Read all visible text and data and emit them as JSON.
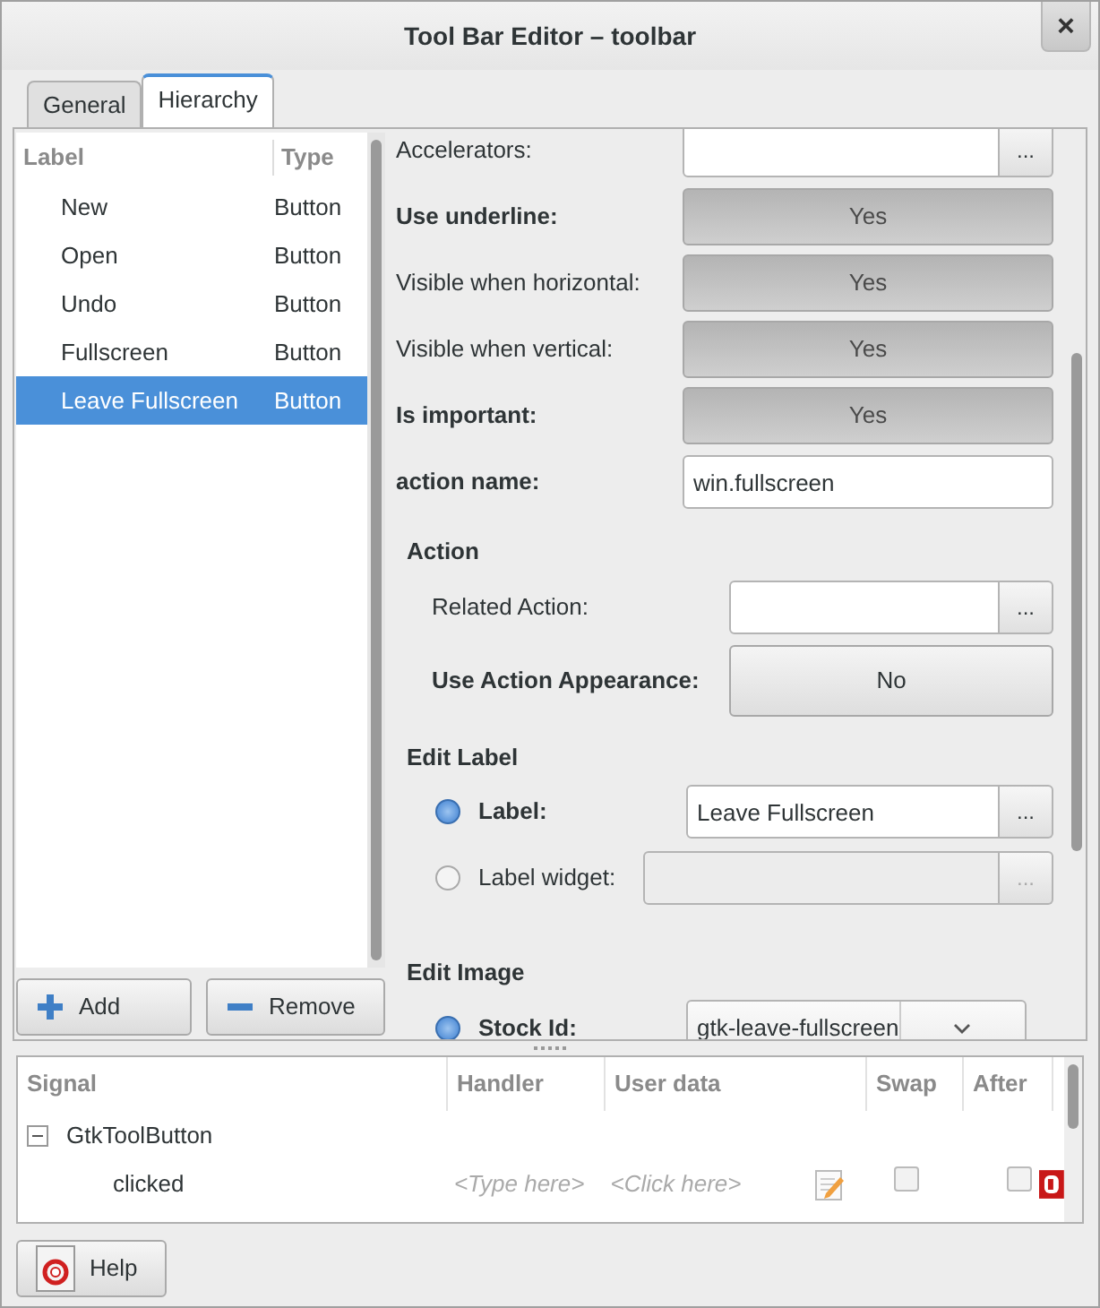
{
  "window": {
    "title": "Tool Bar Editor – toolbar",
    "close": "×"
  },
  "tabs": [
    {
      "label": "General",
      "selected": false
    },
    {
      "label": "Hierarchy",
      "selected": true
    }
  ],
  "hierarchy": {
    "columns": [
      "Label",
      "Type"
    ],
    "rows": [
      {
        "label": "New",
        "type": "Button",
        "selected": false
      },
      {
        "label": "Open",
        "type": "Button",
        "selected": false
      },
      {
        "label": "Undo",
        "type": "Button",
        "selected": false
      },
      {
        "label": "Fullscreen",
        "type": "Button",
        "selected": false
      },
      {
        "label": "Leave Fullscreen",
        "type": "Button",
        "selected": true
      }
    ],
    "buttons": [
      {
        "kind": "add",
        "label": "Add"
      },
      {
        "kind": "remove",
        "label": "Remove"
      }
    ]
  },
  "properties": {
    "rows": [
      {
        "kind": "entry-button",
        "label": "Accelerators:",
        "bold": false,
        "value": "",
        "button": "..."
      },
      {
        "kind": "toggle",
        "label": "Use underline:",
        "bold": true,
        "value": "Yes",
        "active": true
      },
      {
        "kind": "toggle",
        "label": "Visible when horizontal:",
        "bold": false,
        "value": "Yes",
        "active": true
      },
      {
        "kind": "toggle",
        "label": "Visible when vertical:",
        "bold": false,
        "value": "Yes",
        "active": true
      },
      {
        "kind": "toggle",
        "label": "Is important:",
        "bold": true,
        "value": "Yes",
        "active": true
      },
      {
        "kind": "entry",
        "label": "action name:",
        "bold": true,
        "value": "win.fullscreen"
      }
    ],
    "sections": [
      {
        "heading": "Action",
        "rows": [
          {
            "kind": "entry-button",
            "label": "Related Action:",
            "bold": false,
            "value": "",
            "button": "..."
          },
          {
            "kind": "toggle",
            "label": "Use Action Appearance:",
            "bold": true,
            "value": "No",
            "active": false
          }
        ]
      },
      {
        "heading": "Edit Label",
        "rows": [
          {
            "kind": "radio-entry",
            "label": "Label:",
            "bold": true,
            "selected": true,
            "value": "Leave Fullscreen",
            "button": "...",
            "disabled": false
          },
          {
            "kind": "radio-entry",
            "label": "Label widget:",
            "bold": false,
            "selected": false,
            "value": "",
            "button": "...",
            "disabled": true
          }
        ]
      },
      {
        "heading": "Edit Image",
        "rows": [
          {
            "kind": "radio-combo",
            "label": "Stock Id:",
            "bold": true,
            "selected": true,
            "value": "gtk-leave-fullscreen"
          }
        ]
      }
    ]
  },
  "signals": {
    "columns": [
      "Signal",
      "Handler",
      "User data",
      "Swap",
      "After"
    ],
    "rows": [
      {
        "signal": "GtkToolButton",
        "expanded": true,
        "children": [
          {
            "signal": "clicked",
            "handler": "<Type here>",
            "user_data": "<Click here>",
            "swap": false,
            "after": false
          }
        ]
      }
    ]
  },
  "help": {
    "label": "Help"
  }
}
